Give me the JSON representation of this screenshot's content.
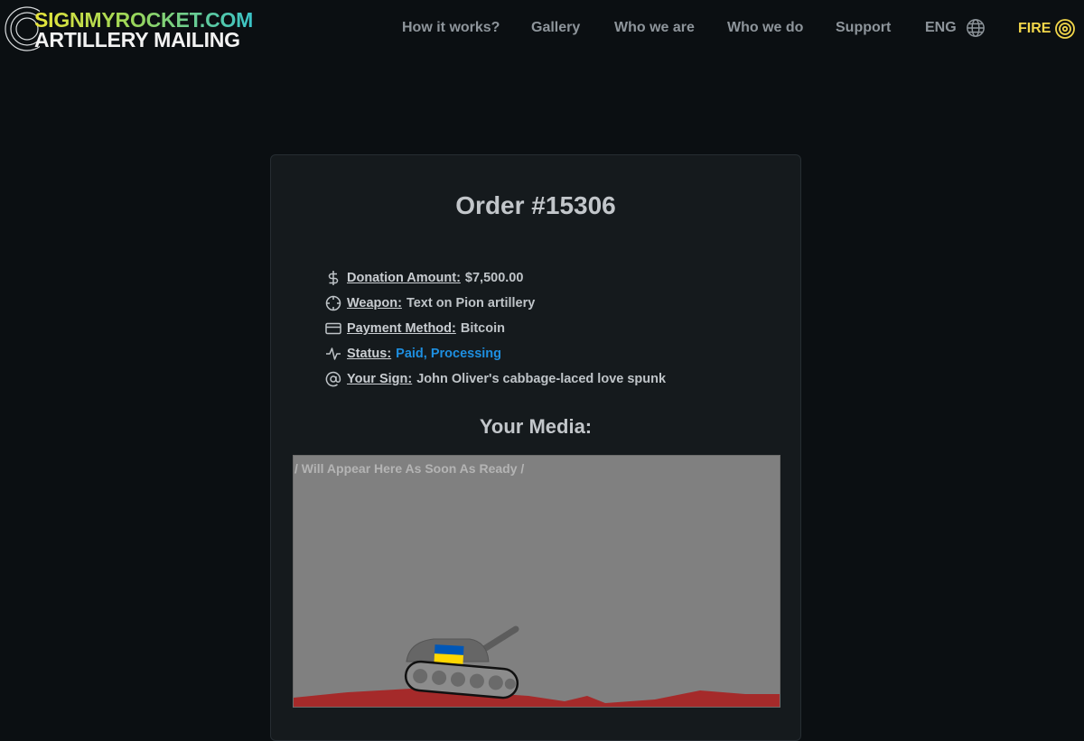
{
  "header": {
    "logo": {
      "line1": "SIGNMYROCKET.COM",
      "line2": "ARTILLERY MAILING"
    },
    "nav": [
      {
        "label": "How it works?"
      },
      {
        "label": "Gallery"
      },
      {
        "label": "Who we are"
      },
      {
        "label": "Who we do"
      },
      {
        "label": "Support"
      }
    ],
    "language": {
      "label": "ENG",
      "icon": "globe-icon"
    },
    "fire": {
      "label": "FIRE",
      "icon": "target-icon"
    }
  },
  "order": {
    "title": "Order #15306",
    "details": [
      {
        "icon": "dollar-icon",
        "label": "Donation Amount:",
        "value": "$7,500.00"
      },
      {
        "icon": "crosshair-icon",
        "label": "Weapon:",
        "value": "Text on Pion artillery"
      },
      {
        "icon": "credit-card-icon",
        "label": "Payment Method:",
        "value": "Bitcoin"
      },
      {
        "icon": "activity-icon",
        "label": "Status:",
        "value": "Paid, Processing"
      },
      {
        "icon": "at-sign-icon",
        "label": "Your Sign:",
        "value": "John Oliver's cabbage-laced love spunk"
      }
    ]
  },
  "media": {
    "title": "Your Media:",
    "placeholder": "/ Will Appear Here As Soon As Ready /"
  },
  "colors": {
    "background": "#0b0f12",
    "card": "#151a1d",
    "status_blue": "#1e8fe0",
    "fire_yellow": "#f2d64a",
    "ground_red": "#a52a2a",
    "flag_blue": "#0057b7",
    "flag_yellow": "#ffd700"
  }
}
